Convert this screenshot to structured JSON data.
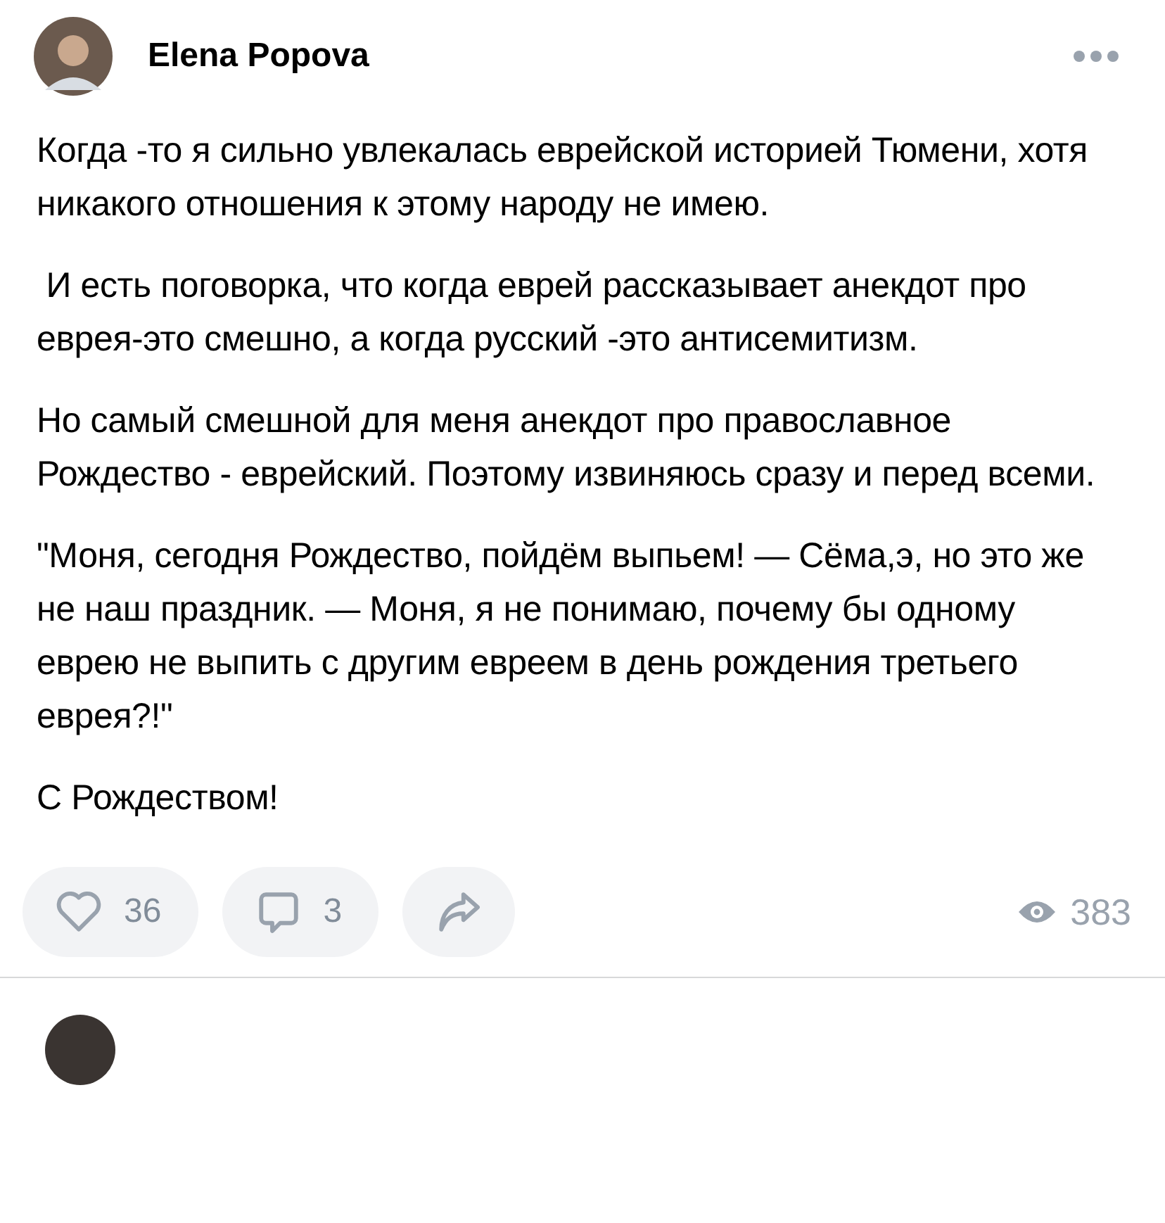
{
  "post": {
    "author": "Elena Popova",
    "paragraphs": [
      "Когда -то я сильно увлекалась еврейской историей Тюмени, хотя никакого отношения к этому народу не имею.",
      " И есть поговорка, что когда еврей рассказывает анекдот про еврея-это смешно, а когда русский -это антисемитизм.",
      "Но самый смешной для меня анекдот про православное Рождество - еврейский. Поэтому извиняюсь сразу и перед всеми.",
      "\"Моня, сегодня Рождество, пойдём выпьем! — Сёма,э, но это же не наш праздник. — Моня, я не понимаю, почему бы одному еврею не выпить с другим евреем в день рождения третьего еврея?!\"",
      "С Рождеством!"
    ],
    "likes": "36",
    "comments": "3",
    "views": "383"
  }
}
